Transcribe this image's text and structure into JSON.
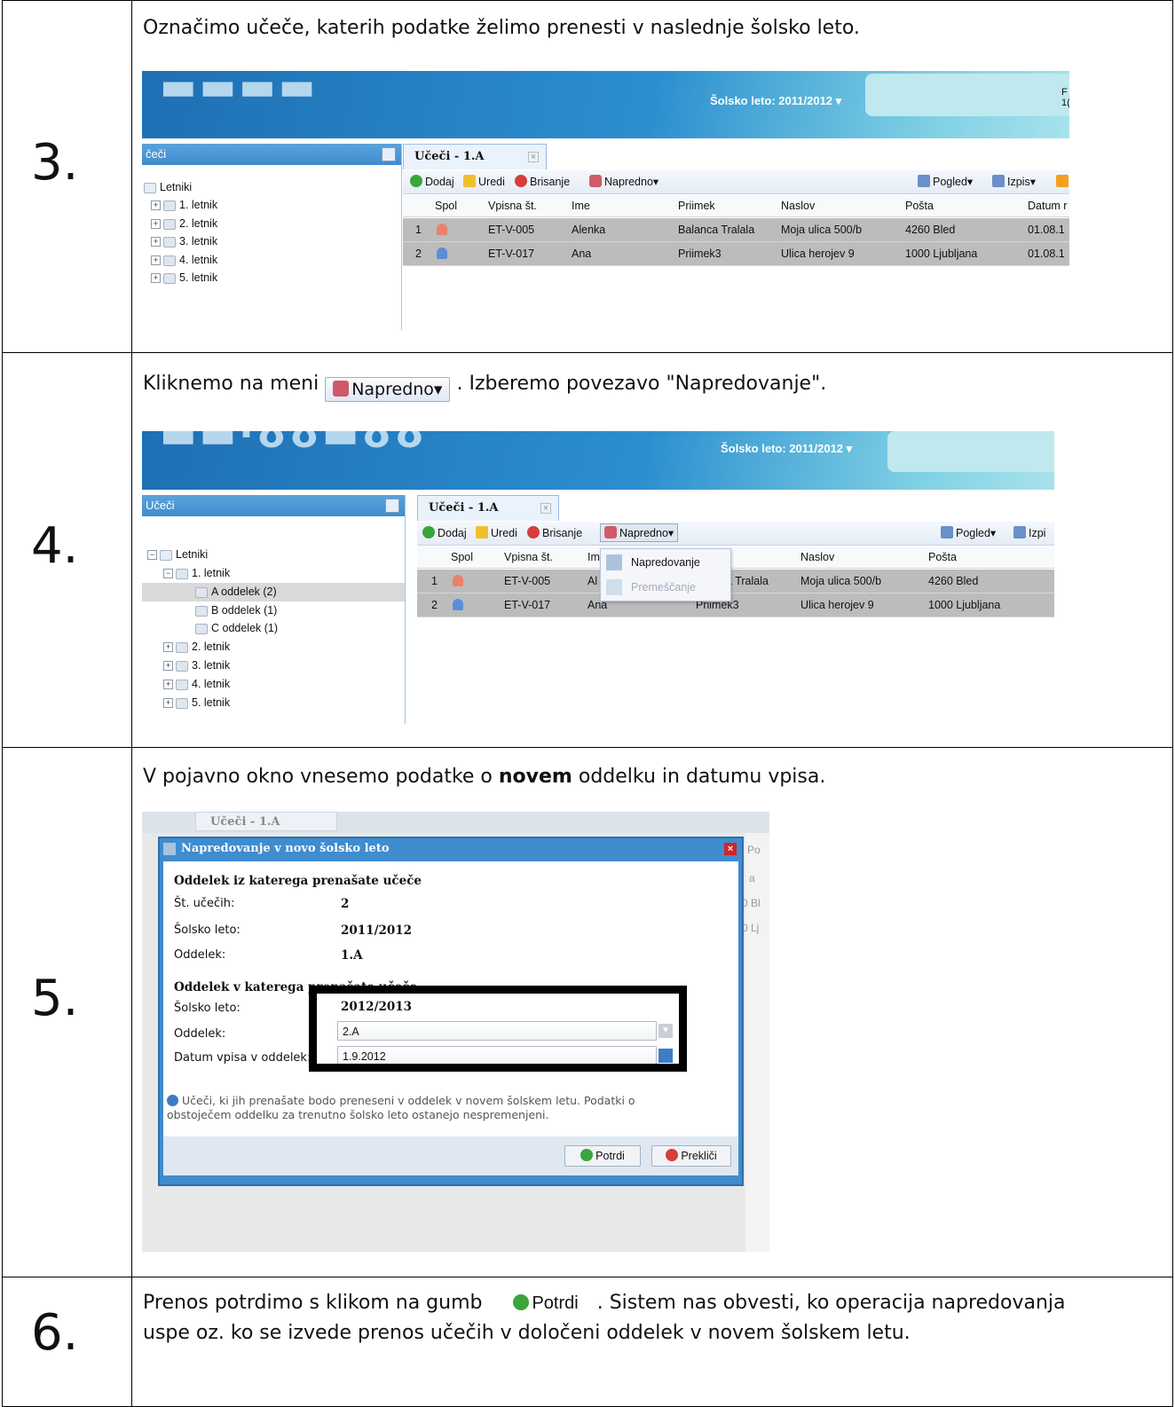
{
  "steps": [
    {
      "number": "3.",
      "instruction": "Označimo učeče, katerih podatke želimo prenesti v naslednje šolsko leto.",
      "screen": {
        "year_label": "Šolsko leto: 2011/2012 ▾",
        "right_fragment": "F\n1(",
        "panel_title": "čeči",
        "tree_root": "Letniki",
        "tree_items": [
          "1. letnik",
          "2. letnik",
          "3. letnik",
          "4. letnik",
          "5. letnik"
        ],
        "tab_label": "Učeči - 1.A",
        "toolbar": {
          "add": "Dodaj",
          "edit": "Uredi",
          "delete": "Brisanje",
          "advanced": "Napredno▾",
          "view": "Pogled▾",
          "print": "Izpis▾"
        },
        "columns": [
          "Spol",
          "Vpisna št.",
          "Ime",
          "Priimek",
          "Naslov",
          "Pošta",
          "Datum r"
        ],
        "rows": [
          {
            "n": "1",
            "vpisna": "ET-V-005",
            "ime": "Alenka",
            "priimek": "Balanca Tralala",
            "naslov": "Moja ulica 500/b",
            "posta": "4260 Bled",
            "datum": "01.08.1"
          },
          {
            "n": "2",
            "vpisna": "ET-V-017",
            "ime": "Ana",
            "priimek": "Priimek3",
            "naslov": "Ulica herojev 9",
            "posta": "1000 Ljubljana",
            "datum": "01.08.1"
          }
        ]
      }
    },
    {
      "number": "4.",
      "instruction_pre": "Kliknemo na meni",
      "instruction_button": "Napredno▾",
      "instruction_post": ". Izberemo povezavo \"Napredovanje\".",
      "screen": {
        "year_label": "Šolsko leto: 2011/2012 ▾",
        "panel_title": "Učeči",
        "tree_root": "Letniki",
        "tree_expanded": "1. letnik",
        "tree_sub": [
          "A oddelek (2)",
          "B oddelek (1)",
          "C oddelek (1)"
        ],
        "tree_items": [
          "2. letnik",
          "3. letnik",
          "4. letnik",
          "5. letnik"
        ],
        "tab_label": "Učeči - 1.A",
        "toolbar": {
          "add": "Dodaj",
          "edit": "Uredi",
          "delete": "Brisanje",
          "advanced": "Napredno▾",
          "view": "Pogled▾",
          "print": "Izpi"
        },
        "columns": [
          "Spol",
          "Vpisna št.",
          "Im",
          "Naslov",
          "Pošta"
        ],
        "menu": [
          "Napredovanje",
          "Premeščanje"
        ],
        "rows": [
          {
            "n": "1",
            "vpisna": "ET-V-005",
            "ime": "Al",
            "priimek": "a Tralala",
            "naslov": "Moja ulica 500/b",
            "posta": "4260 Bled"
          },
          {
            "n": "2",
            "vpisna": "ET-V-017",
            "ime": "Ana",
            "priimek": "Priimek3",
            "naslov": "Ulica herojev 9",
            "posta": "1000 Ljubljana"
          }
        ]
      }
    },
    {
      "number": "5.",
      "instruction_pre": "V pojavno okno vnesemo podatke o ",
      "instruction_bold": "novem",
      "instruction_post": " oddelku in datumu vpisa.",
      "screen": {
        "tab_label": "Učeči - 1.A",
        "dialog_title": "Napredovanje v novo šolsko leto",
        "section1": "Oddelek iz katerega prenašate učeče",
        "st_ucecih_label": "Št. učečih:",
        "st_ucecih_value": "2",
        "solsko_leto_label": "Šolsko leto:",
        "solsko_leto_value": "2011/2012",
        "oddelek_label": "Oddelek:",
        "oddelek_value": "1.A",
        "section2": "Oddelek v katerega prenašate učeče",
        "new_leto_value": "2012/2013",
        "new_oddelek_value": "2.A",
        "datum_label": "Datum vpisa v oddelek:",
        "datum_value": "1.9.2012",
        "info": "Učeči, ki jih prenašate bodo preneseni v oddelek v novem šolskem letu. Podatki o obstoječem oddelku za trenutno šolsko leto ostanejo nespremenjeni.",
        "confirm": "Potrdi",
        "cancel": "Prekliči",
        "side_fragments": [
          "Po",
          "a",
          "0 Bl",
          "0 Lj"
        ]
      }
    },
    {
      "number": "6.",
      "line1_pre": "Prenos potrdimo s klikom na gumb",
      "line1_button": "Potrdi",
      "line1_post": ". Sistem nas obvesti, ko operacija napredovanja",
      "line2": "uspe oz. ko se izvede prenos učečih v določeni oddelek v novem šolskem letu."
    }
  ]
}
